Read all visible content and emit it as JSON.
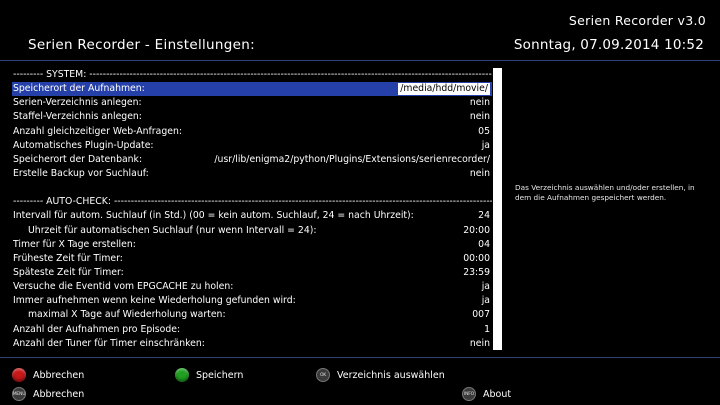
{
  "header": {
    "plugin_name": "Serien Recorder v3.0",
    "title": "Serien Recorder - Einstellungen:",
    "datetime": "Sonntag, 07.09.2014  10:52"
  },
  "config_rows": [
    {
      "label": "--------- SYSTEM: ----------------------------------------------------------------------------------------------------------------------------------",
      "value": "",
      "type": "section"
    },
    {
      "label": "Speicherort der Aufnahmen:",
      "value": "/media/hdd/movie/",
      "type": "selected"
    },
    {
      "label": "Serien-Verzeichnis anlegen:",
      "value": "nein",
      "type": "normal"
    },
    {
      "label": "Staffel-Verzeichnis anlegen:",
      "value": "nein",
      "type": "normal"
    },
    {
      "label": "Anzahl gleichzeitiger Web-Anfragen:",
      "value": "05",
      "type": "normal"
    },
    {
      "label": "Automatisches Plugin-Update:",
      "value": "ja",
      "type": "normal"
    },
    {
      "label": "Speicherort der Datenbank:",
      "value": "/usr/lib/enigma2/python/Plugins/Extensions/serienrecorder/",
      "type": "normal"
    },
    {
      "label": "Erstelle Backup vor Suchlauf:",
      "value": "nein",
      "type": "normal"
    },
    {
      "label": "",
      "value": "",
      "type": "blank"
    },
    {
      "label": "--------- AUTO-CHECK: ---------------------------------------------------------------------------------------------------------------------------",
      "value": "",
      "type": "section"
    },
    {
      "label": "Intervall für autom. Suchlauf (in Std.) (00 = kein autom. Suchlauf, 24 = nach Uhrzeit):",
      "value": "24",
      "type": "normal"
    },
    {
      "label": "Uhrzeit für automatischen Suchlauf (nur wenn Intervall = 24):",
      "value": "20:00",
      "type": "indent"
    },
    {
      "label": "Timer für X Tage erstellen:",
      "value": "04",
      "type": "normal"
    },
    {
      "label": "Früheste Zeit für Timer:",
      "value": "00:00",
      "type": "normal"
    },
    {
      "label": "Späteste Zeit für Timer:",
      "value": "23:59",
      "type": "normal"
    },
    {
      "label": "Versuche die Eventid vom EPGCACHE zu holen:",
      "value": "ja",
      "type": "normal"
    },
    {
      "label": "Immer aufnehmen wenn keine Wiederholung gefunden wird:",
      "value": "ja",
      "type": "normal"
    },
    {
      "label": "maximal X Tage auf Wiederholung warten:",
      "value": "007",
      "type": "indent"
    },
    {
      "label": "Anzahl der Aufnahmen pro Episode:",
      "value": "1",
      "type": "normal"
    },
    {
      "label": "Anzahl der Tuner für Timer einschränken:",
      "value": "nein",
      "type": "normal"
    }
  ],
  "help_text": "Das Verzeichnis auswählen und/oder erstellen, in dem die Aufnahmen gespeichert werden.",
  "footer": {
    "red_label": "Abbrechen",
    "green_label": "Speichern",
    "ok_key": "OK",
    "ok_label": "Verzeichnis auswählen",
    "menu_key": "MENU",
    "menu_label": "Abbrechen",
    "info_key": "INFO",
    "info_label": "About"
  },
  "colors": {
    "selection": "#2540a8",
    "red_button": "#c81818",
    "green_button": "#20a020"
  }
}
